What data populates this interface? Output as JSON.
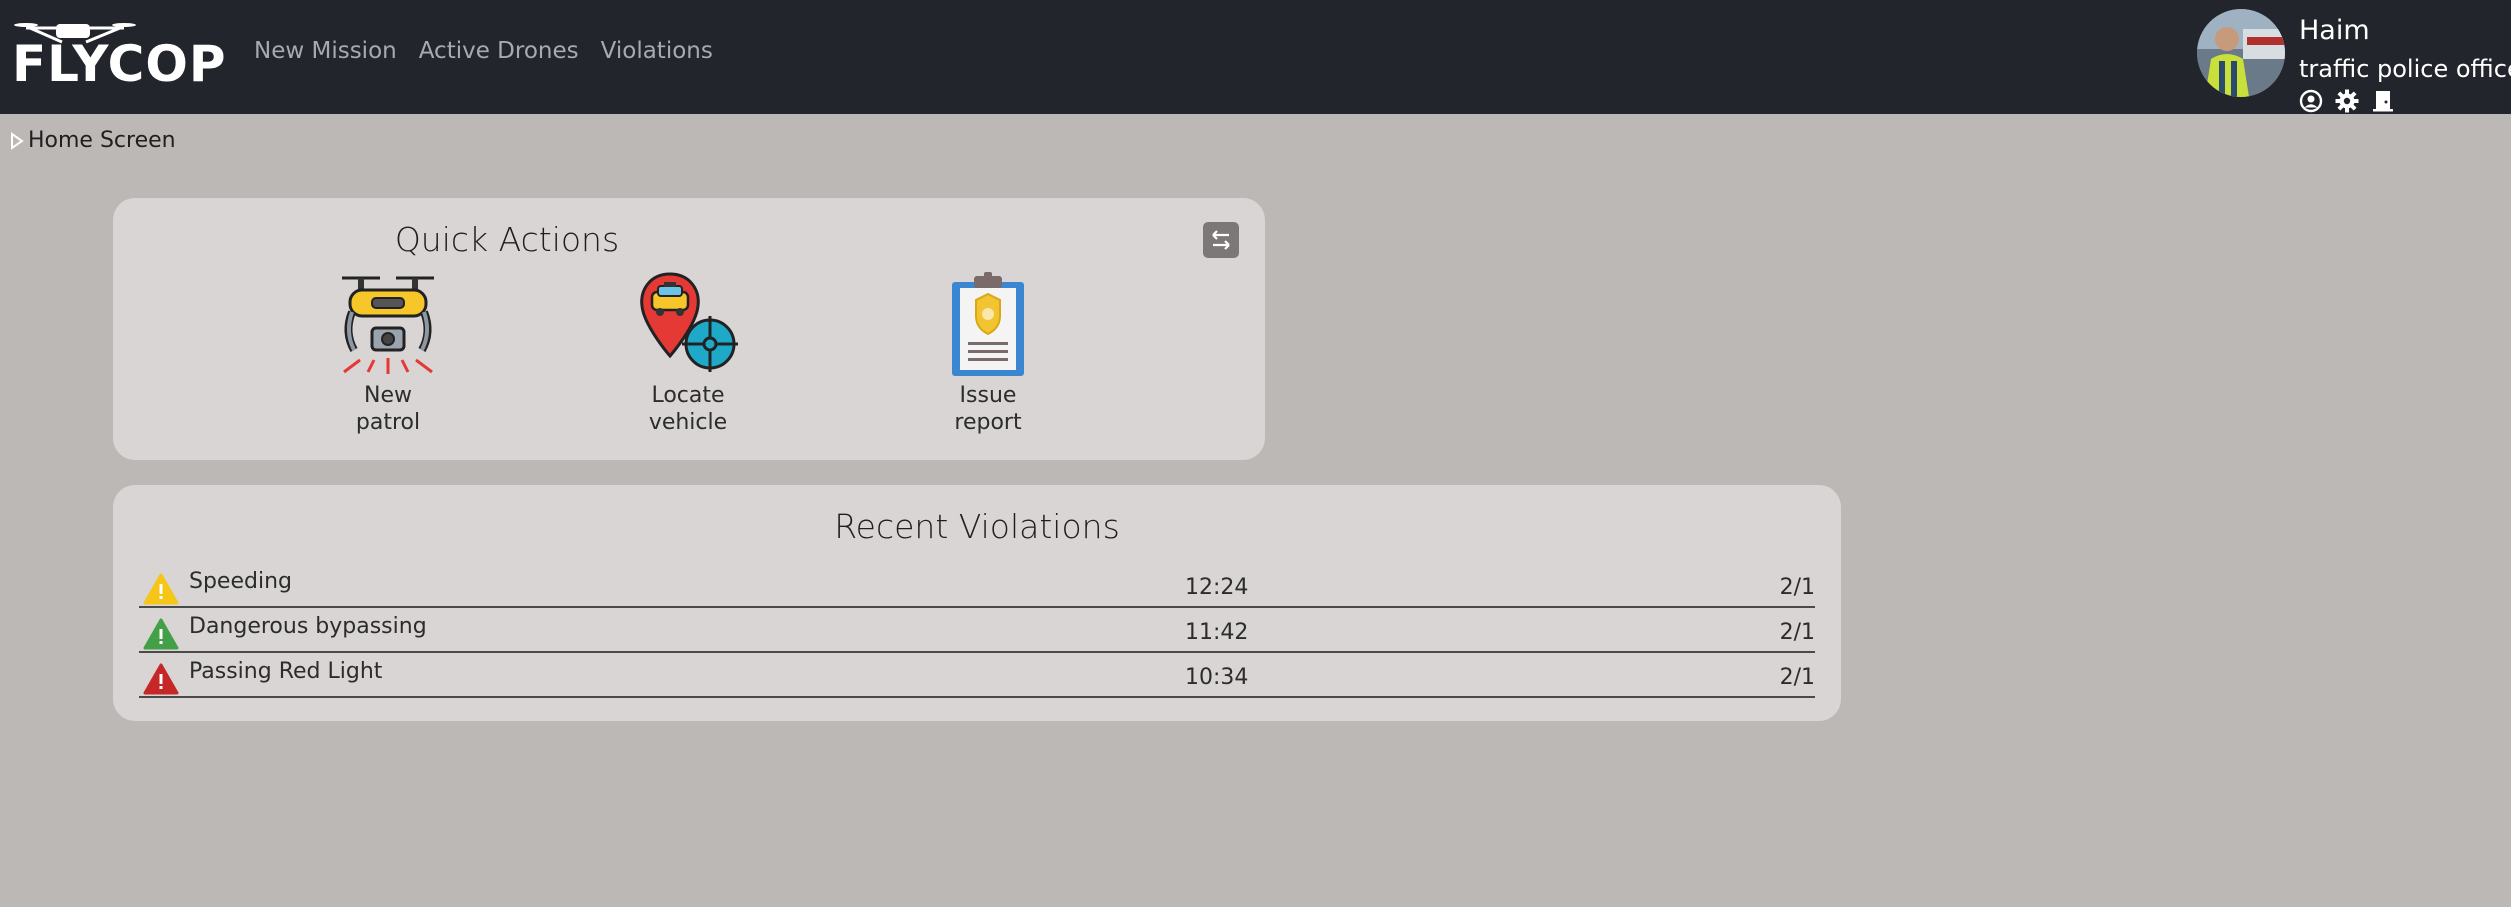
{
  "app": {
    "logo_text": "FLYCOP"
  },
  "nav": {
    "links": [
      {
        "label": "New Mission"
      },
      {
        "label": "Active Drones"
      },
      {
        "label": "Violations"
      }
    ]
  },
  "user": {
    "name": "Haim",
    "role": "traffic police officer",
    "icons": [
      "user-circle-icon",
      "gear-icon",
      "logout-door-icon"
    ]
  },
  "breadcrumb": {
    "label": "Home Screen"
  },
  "quick_actions": {
    "title": "Quick Actions",
    "swap_icon": "swap-arrows-icon",
    "actions": [
      {
        "label": "New\npatrol",
        "icon": "drone-icon"
      },
      {
        "label": "Locate\nvehicle",
        "icon": "locate-vehicle-icon"
      },
      {
        "label": "Issue\nreport",
        "icon": "report-clipboard-icon"
      }
    ]
  },
  "recent_violations": {
    "title": "Recent Violations",
    "rows": [
      {
        "type": "Speeding",
        "time": "12:24",
        "date": "2/1",
        "severity_color": "#f5c518"
      },
      {
        "type": "Dangerous bypassing",
        "time": "11:42",
        "date": "2/1",
        "severity_color": "#43a047"
      },
      {
        "type": "Passing Red Light",
        "time": "10:34",
        "date": "2/1",
        "severity_color": "#c62828"
      }
    ]
  },
  "colors": {
    "navbar": "#22252b",
    "background": "#bcb8b6",
    "card": "#d8d5d4",
    "nav_link": "#a7abb1"
  }
}
